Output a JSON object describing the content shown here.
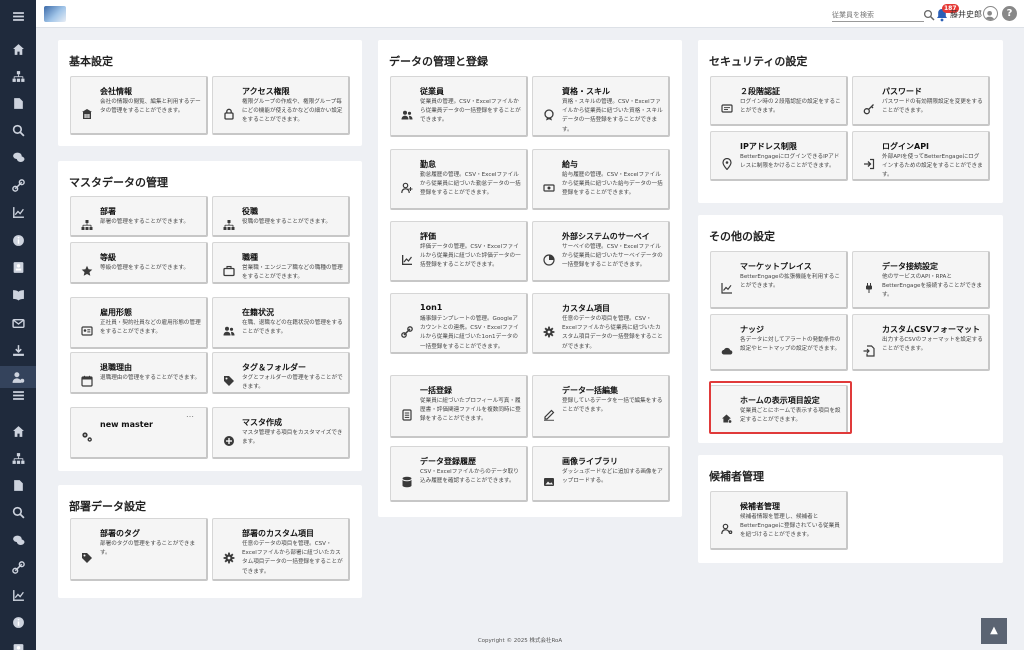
{
  "header": {
    "search_placeholder": "従業員を検索",
    "notification_count": "187",
    "user_name": "藤井史郎",
    "help_label": "?"
  },
  "sidebar": {
    "icons": [
      "menu-icon",
      "home-icon",
      "org-chart-icon",
      "document-icon",
      "search-icon",
      "chat-icon",
      "link-icon",
      "chart-icon",
      "info-icon",
      "profile-card-icon",
      "book-icon",
      "mail-icon",
      "download-icon",
      "user-settings-icon",
      "menu-icon",
      "home-icon",
      "org-chart-icon",
      "document-icon",
      "search-icon",
      "chat-icon",
      "link-icon",
      "chart-icon",
      "info-icon",
      "profile-card-icon"
    ]
  },
  "sections": [
    {
      "title": "基本設定",
      "cards": [
        {
          "icon": "building-icon",
          "title": "会社情報",
          "desc": "会社の情報の閲覧、編集と利用するデータの管理をすることができます。"
        },
        {
          "icon": "lock-icon",
          "title": "アクセス権限",
          "desc": "権限グループの作成や、権限グループ毎にどの機能が使えるかなどの細かい設定をすることができます。"
        }
      ]
    },
    {
      "title": "マスタデータの管理",
      "cards": [
        {
          "icon": "org-chart-icon",
          "title": "部署",
          "desc": "部署の管理をすることができます。"
        },
        {
          "icon": "org-chart-icon",
          "title": "役職",
          "desc": "役職の管理をすることができます。"
        },
        {
          "icon": "star-icon",
          "title": "等級",
          "desc": "等級の管理をすることができます。"
        },
        {
          "icon": "briefcase-icon",
          "title": "職種",
          "desc": "営業職・エンジニア職などの職種の管理をすることができます。"
        },
        {
          "icon": "id-card-icon",
          "title": "雇用形態",
          "desc": "正社員・契約社員などの雇用形態の管理をすることができます。"
        },
        {
          "icon": "users-icon",
          "title": "在籍状況",
          "desc": "在職、退職などの在籍状況の管理をすることができます。"
        },
        {
          "icon": "calendar-icon",
          "title": "退職理由",
          "desc": "退職理由の管理をすることができます。"
        },
        {
          "icon": "tag-icon",
          "title": "タグ＆フォルダー",
          "desc": "タグとフォルダーの管理をすることができます。"
        },
        {
          "icon": "gears-icon",
          "title": "new master",
          "desc": ""
        },
        {
          "icon": "plus-circle-icon",
          "title": "マスタ作成",
          "desc": "マスタ管理する項目をカスタマイズできます。"
        }
      ],
      "more": "…"
    },
    {
      "title": "部署データ設定",
      "cards": [
        {
          "icon": "tag-icon",
          "title": "部署のタグ",
          "desc": "部署のタグの管理をすることができます。"
        },
        {
          "icon": "gear-icon",
          "title": "部署のカスタム項目",
          "desc": "任意のデータの項目を管理。CSV・Excelファイルから部署に紐づいたカスタム項目データの一括登録をすることができます。"
        }
      ]
    },
    {
      "title": "データの管理と登録",
      "cards": [
        {
          "icon": "users-icon",
          "title": "従業員",
          "desc": "従業員の管理。CSV・Excelファイルから従業員データの一括登録をすることができます。"
        },
        {
          "icon": "badge-icon",
          "title": "資格・スキル",
          "desc": "資格・スキルの管理。CSV・Excelファイルから従業員に紐づいた資格・スキルデータの一括登録をすることができます。"
        },
        {
          "icon": "user-plus-icon",
          "title": "勤怠",
          "desc": "勤怠履歴の管理。CSV・Excelファイルから従業員に紐づいた勤怠データの一括登録をすることができます。"
        },
        {
          "icon": "money-icon",
          "title": "給与",
          "desc": "給与履歴の管理。CSV・Excelファイルから従業員に紐づいた給与データの一括登録をすることができます。"
        },
        {
          "icon": "chart-icon",
          "title": "評価",
          "desc": "評価データの管理。CSV・Excelファイルから従業員に紐づいた評価データの一括登録をすることができます。"
        },
        {
          "icon": "survey-icon",
          "title": "外部システムのサーベイ",
          "desc": "サーベイの管理。CSV・Excelファイルから従業員に紐づいたサーベイデータの一括登録をすることができます。"
        },
        {
          "icon": "link-icon",
          "title": "1on1",
          "desc": "議事録テンプレートの管理。Googleアカウントとの連携。CSV・Excelファイルから従業員に紐づいた1on1データの一括登録をすることができます。"
        },
        {
          "icon": "gear-icon",
          "title": "カスタム項目",
          "desc": "任意のデータの項目を管理。CSV・Excelファイルから従業員に紐づいたカスタム項目データの一括登録をすることができます。"
        },
        {
          "icon": "list-icon",
          "title": "一括登録",
          "desc": "従業員に紐づいたプロフィール写真・履歴書・評価関連ファイルを複数同時に登録をすることができます。"
        },
        {
          "icon": "pen-icon",
          "title": "データ一括編集",
          "desc": "登録しているデータを一括で編集をすることができます。"
        },
        {
          "icon": "database-icon",
          "title": "データ登録履歴",
          "desc": "CSV・Excelファイルからのデータ取り込み履歴を確認することができます。"
        },
        {
          "icon": "image-icon",
          "title": "画像ライブラリ",
          "desc": "ダッシュボードなどに追加する画像をアップロードする。"
        }
      ]
    },
    {
      "title": "セキュリティの設定",
      "cards": [
        {
          "icon": "message-icon",
          "title": "２段階認証",
          "desc": "ログイン時の２段階認証の設定をすることができます。"
        },
        {
          "icon": "key-icon",
          "title": "パスワード",
          "desc": "パスワードの有効期限設定を変更をすることができます。"
        },
        {
          "icon": "location-icon",
          "title": "IPアドレス制限",
          "desc": "BetterEngageにログインできるIPアドレスに制限をかけることができます。"
        },
        {
          "icon": "sign-in-icon",
          "title": "ログインAPI",
          "desc": "外部APIを使ってBetterEngageにログインするための設定をすることができます。"
        }
      ]
    },
    {
      "title": "その他の設定",
      "cards": [
        {
          "icon": "chart-line-icon",
          "title": "マーケットプレイス",
          "desc": "BetterEngageの拡張機能を利用することができます。"
        },
        {
          "icon": "plug-icon",
          "title": "データ接続設定",
          "desc": "他のサービスのAPI・RPAとBetterEngageを接続することができます。"
        },
        {
          "icon": "cloud-icon",
          "title": "ナッジ",
          "desc": "各データに対してアラートの発動条件の設定やヒートマップの設定ができます。"
        },
        {
          "icon": "file-import-icon",
          "title": "カスタムCSVフォーマット",
          "desc": "出力するCSVのフォーマットを設定することができます。"
        },
        {
          "icon": "home-settings-icon",
          "title": "ホームの表示項目設定",
          "desc": "従業員ごとにホームで表示する項目を設定することができます。"
        }
      ]
    },
    {
      "title": "候補者管理",
      "cards": [
        {
          "icon": "user-gear-icon",
          "title": "候補者管理",
          "desc": "候補者情報を管理し、候補者とBetterEngageに登録されている従業員を紐づけることができます。"
        }
      ]
    }
  ],
  "footer": {
    "text": "Copyright © 2025 株式会社RoA",
    "back_to_top": "▲"
  },
  "colors": {
    "sidebar": "#1f2a3c",
    "highlight": "#e03a3a",
    "badge": "#e53935",
    "background": "#eef0f4"
  }
}
